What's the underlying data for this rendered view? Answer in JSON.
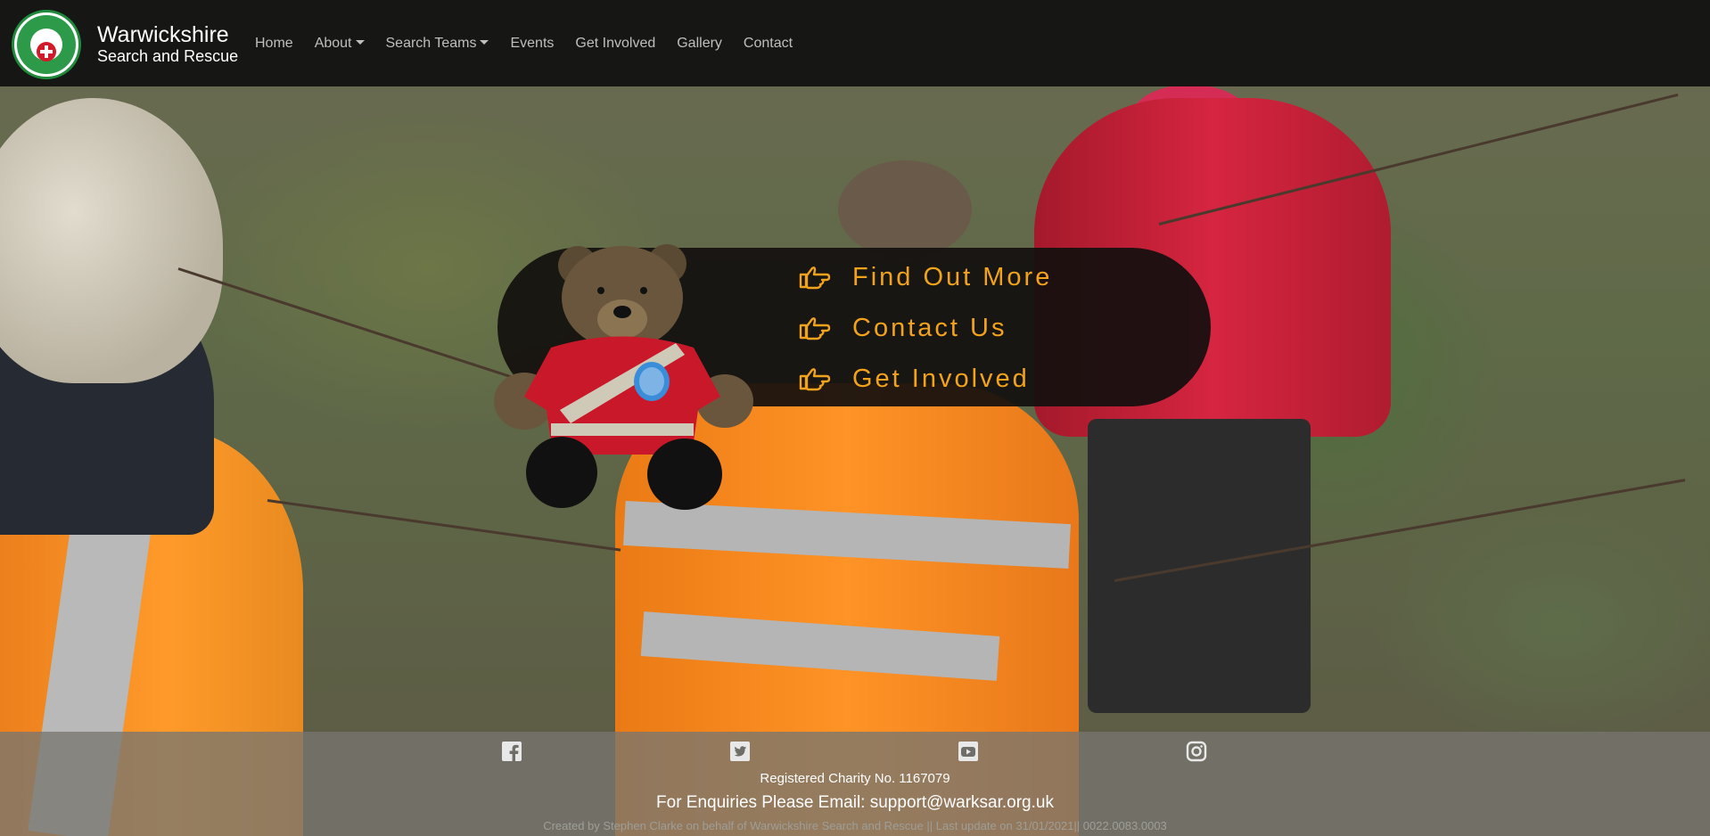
{
  "brand": {
    "title": "Warwickshire",
    "subtitle": "Search and Rescue"
  },
  "nav": {
    "items": [
      {
        "label": "Home"
      },
      {
        "label": "About"
      },
      {
        "label": "Search Teams"
      },
      {
        "label": "Events"
      },
      {
        "label": "Get Involved"
      },
      {
        "label": "Gallery"
      },
      {
        "label": "Contact"
      }
    ]
  },
  "cta": {
    "items": [
      {
        "label": "Find Out More",
        "icon": "hand-point-right-icon"
      },
      {
        "label": "Contact Us",
        "icon": "hand-point-right-icon"
      },
      {
        "label": "Get Involved",
        "icon": "hand-point-right-icon"
      }
    ],
    "accent": "#f2a31b"
  },
  "footer": {
    "social": [
      "facebook-icon",
      "twitter-icon",
      "youtube-icon",
      "instagram-icon"
    ],
    "charity": "Registered Charity No. 1167079",
    "enquiries": "For Enquiries Please Email: support@warksar.org.uk",
    "credits": "Created by Stephen Clarke on behalf of Warwickshire Search and Rescue || Last update on 31/01/2021|| 0022.0083.0003"
  }
}
